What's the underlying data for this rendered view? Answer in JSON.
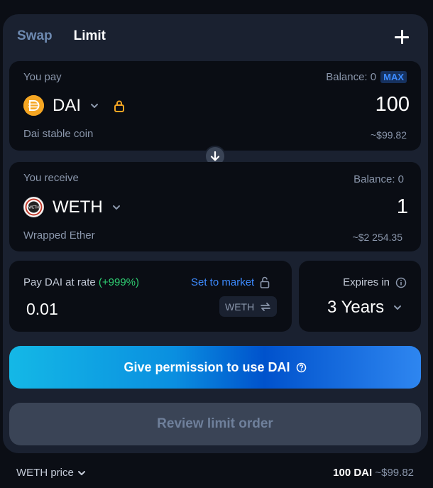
{
  "tabs": {
    "swap": "Swap",
    "limit": "Limit"
  },
  "pay": {
    "label": "You pay",
    "balance": "Balance: 0",
    "max": "MAX",
    "token": "DAI",
    "token_icon": "dai-icon",
    "lock_icon": "lock-icon",
    "amount": "100",
    "token_full_name": "Dai stable coin",
    "usd_value": "~$99.82"
  },
  "receive": {
    "label": "You receive",
    "balance": "Balance: 0",
    "token": "WETH",
    "token_icon": "weth-icon",
    "amount": "1",
    "token_full_name": "Wrapped Ether",
    "usd_value": "~$2 254.35"
  },
  "rate": {
    "label": "Pay DAI at rate",
    "percent": "(+999%)",
    "set_to_market": "Set to market",
    "value": "0.01",
    "unit": "WETH"
  },
  "expires": {
    "label": "Expires in",
    "value": "3 Years"
  },
  "buttons": {
    "permission": "Give permission to use DAI",
    "review": "Review limit order"
  },
  "footer": {
    "price_label": "WETH price",
    "price_amount": "100 DAI",
    "price_usd": "~$99.82"
  },
  "colors": {
    "background": "#0b0e15",
    "widget": "#1a2130",
    "panel": "#0a0d14",
    "accent_blue": "#3d8bff",
    "positive_green": "#2ecc71",
    "dai_orange": "#f5a623",
    "disabled_button": "#3a4456"
  }
}
